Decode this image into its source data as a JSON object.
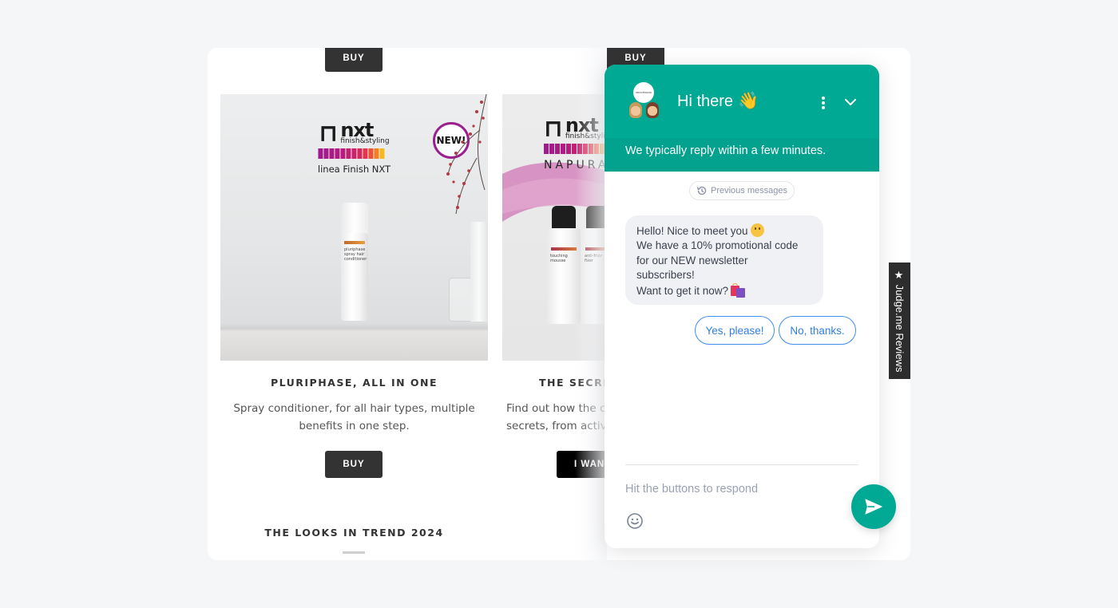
{
  "products": [
    {
      "top_button": "BUY",
      "logo": {
        "brand": "nxt",
        "tagline": "finish&styling",
        "line": "linea Finish NXT"
      },
      "badge": "NEW!",
      "bottle_label": "pluriphase spray hair conditioner",
      "title": "PLURIPHASE, ALL IN ONE",
      "description_lines": [
        "Spray conditioner, for all hair types, multiple",
        "benefits in one step."
      ],
      "button": "BUY"
    },
    {
      "top_button": "BUY",
      "logo": {
        "brand": "nxt",
        "tagline": "finish&styling",
        "line": "NAPURA"
      },
      "bottle_labels": [
        "touching mousse",
        "anti-frizz fixer"
      ],
      "title": "THE SECRET",
      "description_lines": [
        "Find out how the co",
        "secrets, from active"
      ],
      "button": "I WAN"
    }
  ],
  "section": {
    "title": "THE LOOKS IN TREND 2024"
  },
  "logo_colors": [
    "#a1198d",
    "#a61a8a",
    "#ab1b86",
    "#b11c82",
    "#b81d7d",
    "#c21e74",
    "#cc216b",
    "#d7285d",
    "#e2364c",
    "#eb5237",
    "#f27f21",
    "#f7b81d"
  ],
  "chat": {
    "avatar_logo_text": "PROCESSION",
    "title": "Hi there",
    "title_emoji": "👋",
    "reply_time": "We typically reply within a few minutes.",
    "previous_messages": "Previous messages",
    "message_lines": [
      "Hello! Nice to meet you",
      "We have a 10% promotional code",
      "for our NEW newsletter",
      "subscribers!",
      "Want to get it now?"
    ],
    "quick_replies": [
      "Yes, please!",
      "No, thanks."
    ],
    "input_placeholder": "Hit the buttons to respond",
    "accent_color": "#00a994",
    "quick_reply_color": "#3f8ef0"
  },
  "judge_tab": {
    "label": "★ Judge.me Reviews"
  }
}
